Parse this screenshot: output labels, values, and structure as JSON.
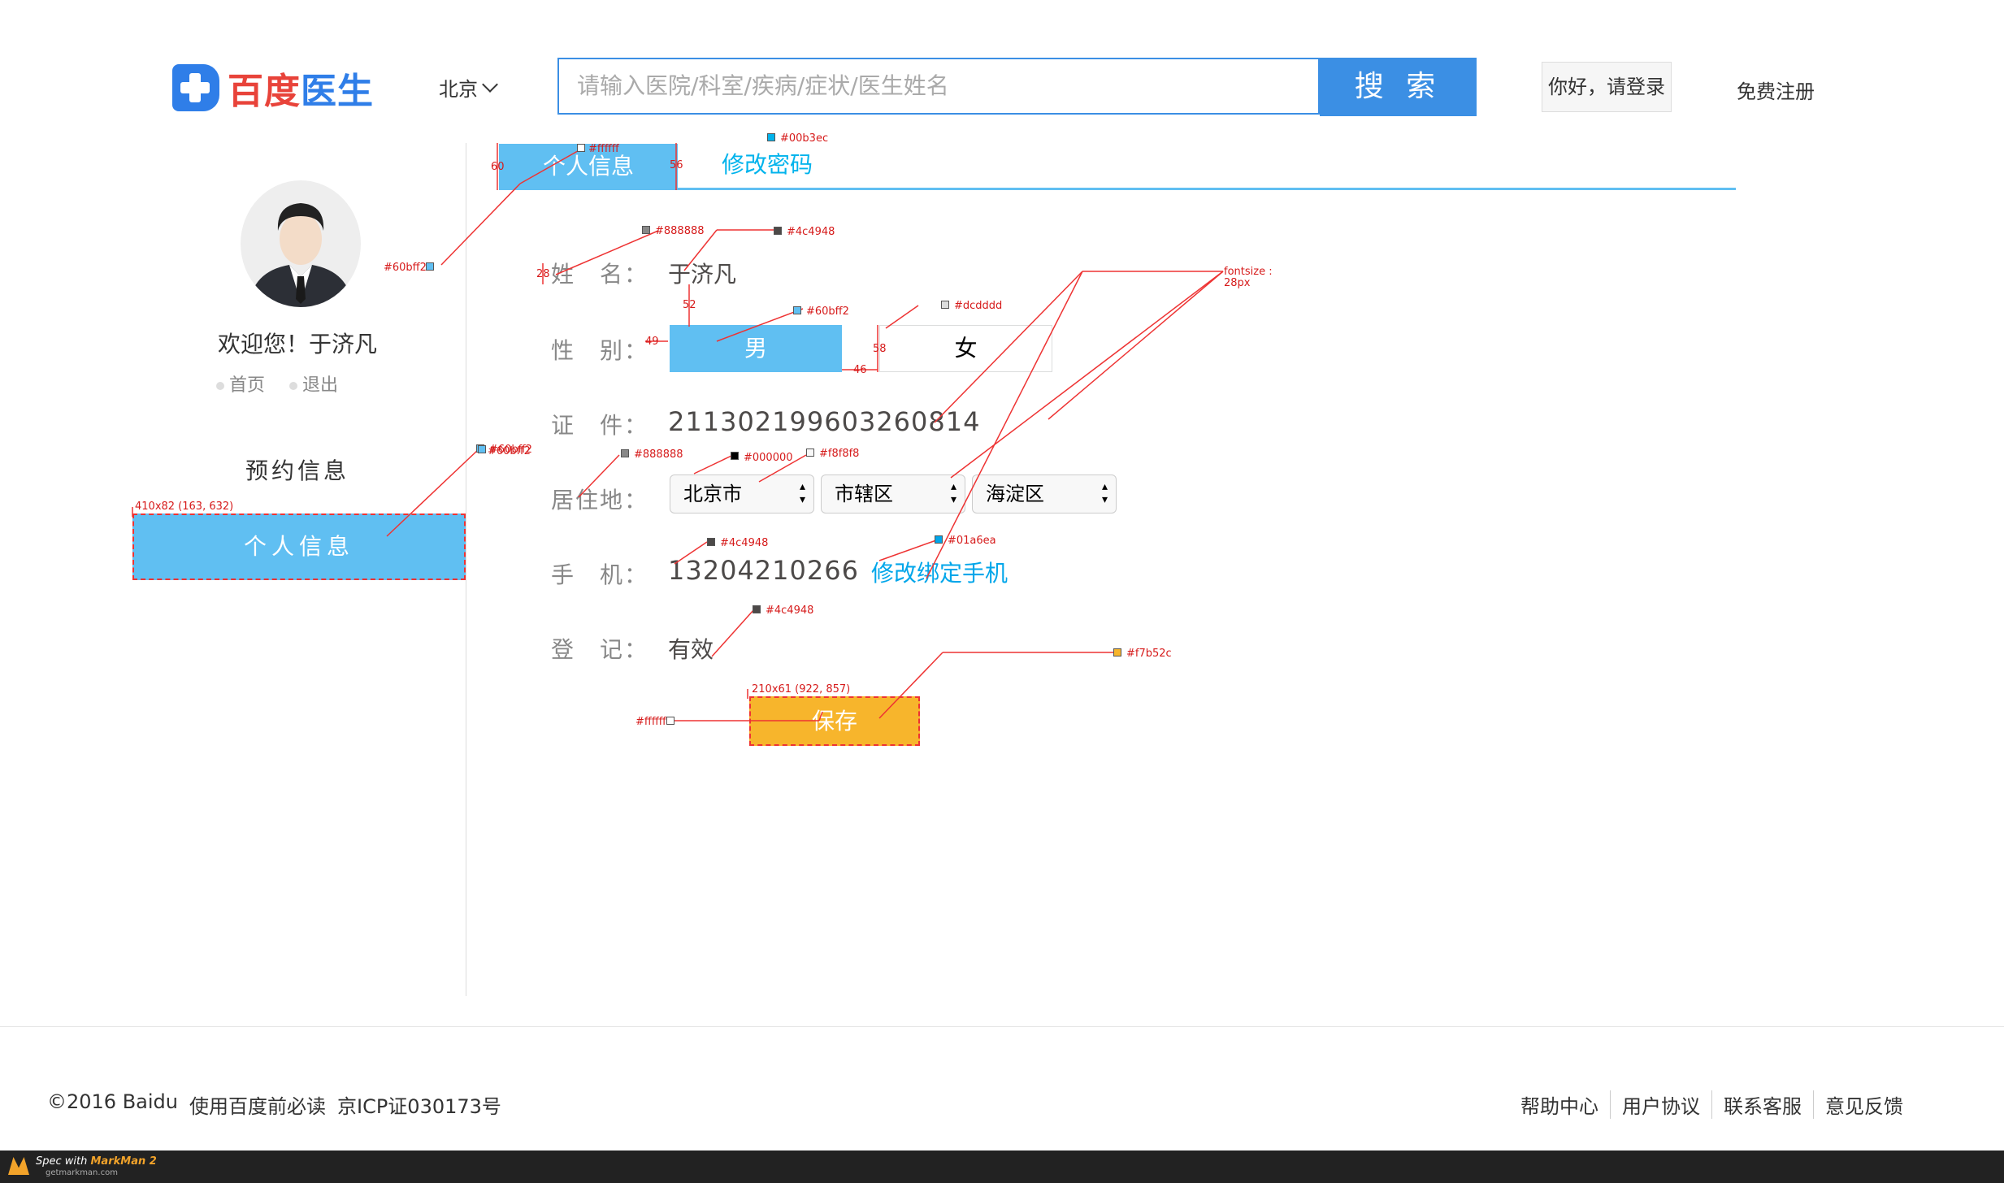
{
  "header": {
    "logo_text_a": "百度",
    "logo_text_b": "医生",
    "city": "北京",
    "search_placeholder": "请输入医院/科室/疾病/症状/医生姓名",
    "search_button": "搜 索",
    "login": "你好，请登录",
    "register": "免费注册"
  },
  "tabs": {
    "active": "个人信息",
    "other": "修改密码"
  },
  "sidebar": {
    "welcome": "欢迎您！于济凡",
    "links": [
      "首页",
      "退出"
    ],
    "heading": "预约信息",
    "active_item": "个人信息"
  },
  "form": {
    "name_label": "姓　名：",
    "name_value": "于济凡",
    "gender_label": "性　别：",
    "gender_male": "男",
    "gender_female": "女",
    "id_label": "证　件：",
    "id_value": "211302199603260814",
    "residence_label": "居住地：",
    "province": "北京市",
    "city": "市辖区",
    "district": "海淀区",
    "phone_label": "手　机：",
    "phone_value": "13204210266",
    "rebind": "修改绑定手机",
    "reg_label": "登　记：",
    "reg_value": "有效",
    "save": "保存"
  },
  "footer": {
    "left": [
      "©2016 Baidu",
      "使用百度前必读",
      "京ICP证030173号"
    ],
    "right": [
      "帮助中心",
      "用户协议",
      "联系客服",
      "意见反馈"
    ]
  },
  "markman": {
    "title_a": "Spec with ",
    "title_b": "MarkMan 2",
    "site": "getmarkman.com"
  },
  "annotations": {
    "c_ffffff": "#ffffff",
    "c_00b3ec": "#00b3ec",
    "c_60bff2": "#60bff2",
    "c_888888": "#888888",
    "c_4c4948": "#4c4948",
    "c_dcdddd": "#dcdddd",
    "c_000000": "#000000",
    "c_f8f8f8": "#f8f8f8",
    "c_01a6ea": "#01a6ea",
    "c_f7b52c": "#f7b52c",
    "fontsize": "fontsize :\n28px",
    "dim_side": "410x82 (163, 632)",
    "dim_save": "210x61 (922, 857)",
    "m60": "60",
    "m56": "56",
    "m28": "28",
    "m52": "52",
    "m49": "49",
    "m58": "58",
    "m46": "46"
  },
  "colors": {
    "primary": "#60bff2",
    "search": "#3b8fe4",
    "link": "#00b3ec",
    "save": "#f7b52c",
    "text": "#4c4948",
    "label": "#888888"
  }
}
